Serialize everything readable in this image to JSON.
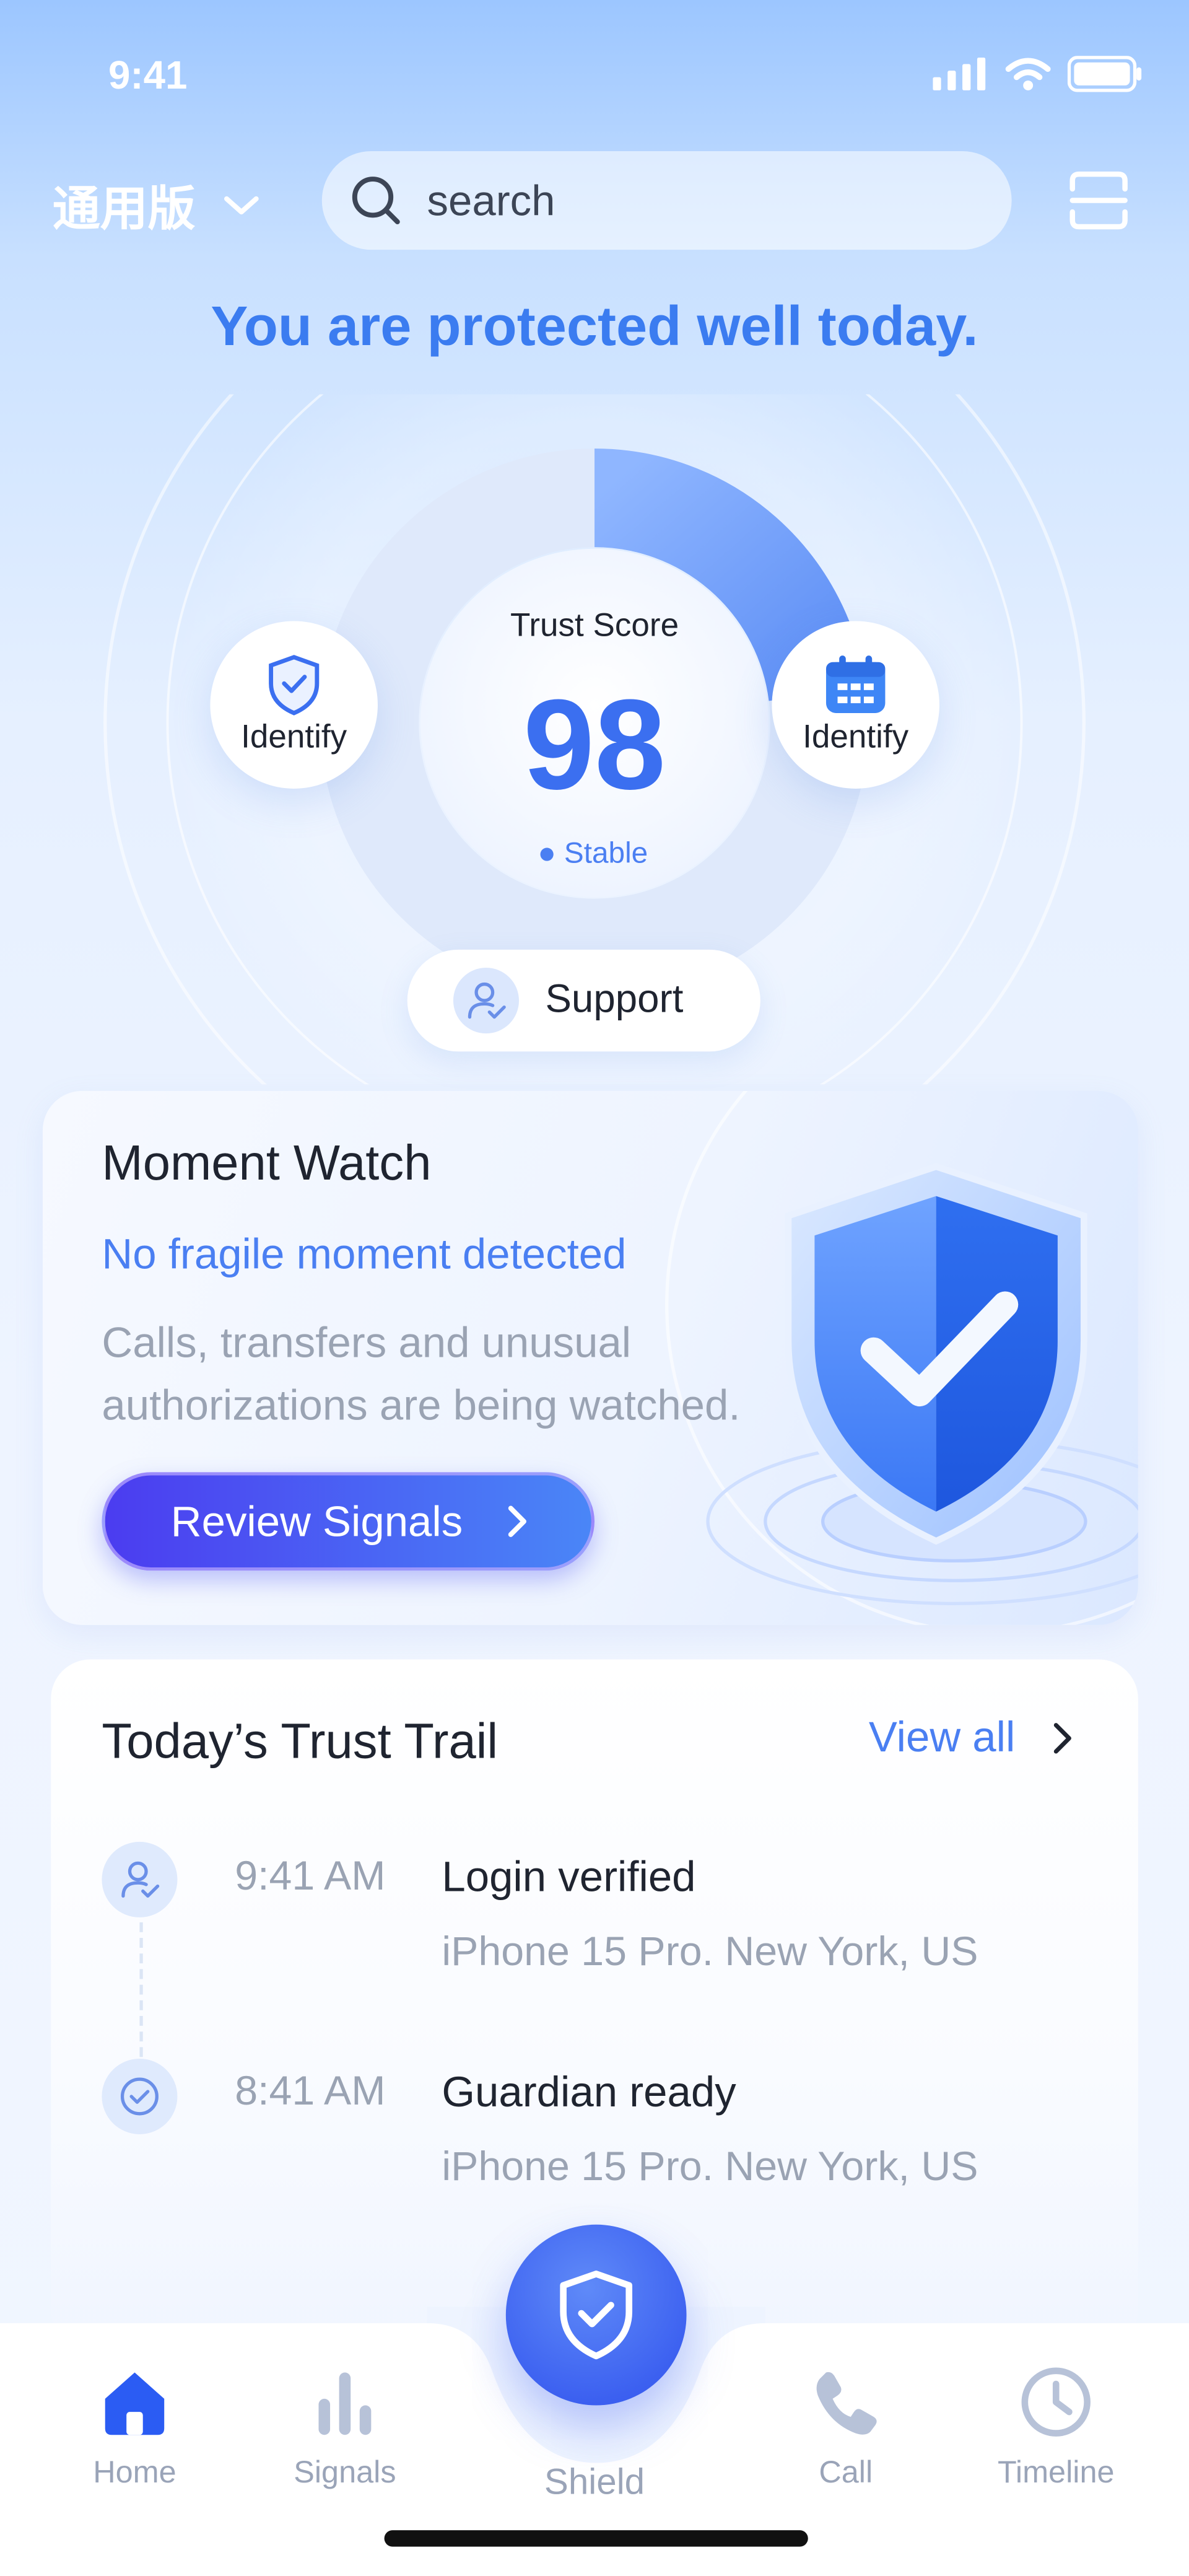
{
  "status_bar": {
    "time": "9:41"
  },
  "header": {
    "edition": "通用版",
    "search_placeholder": "search"
  },
  "headline": "You are protected well today.",
  "trust": {
    "label": "Trust Score",
    "score": "98",
    "state": "Stable",
    "progress": 0.23
  },
  "side_buttons": {
    "left_label": "Identify",
    "right_label": "Identify"
  },
  "support_label": "Support",
  "moment": {
    "title": "Moment Watch",
    "status": "No fragile moment detected",
    "description_line1": "Calls, transfers and unusual",
    "description_line2": "authorizations are being watched.",
    "button_label": "Review Signals"
  },
  "trail": {
    "title": "Today’s Trust Trail",
    "view_all": "View all",
    "items": [
      {
        "time": "9:41 AM",
        "title": "Login verified",
        "subtitle": "iPhone 15 Pro. New York, US"
      },
      {
        "time": "8:41 AM",
        "title": "Guardian ready",
        "subtitle": "iPhone 15 Pro. New York, US"
      }
    ]
  },
  "nav": {
    "items": [
      {
        "label": "Home",
        "icon": "home-icon",
        "active": true
      },
      {
        "label": "Signals",
        "icon": "bar-chart-icon"
      },
      {
        "label": "Shield",
        "icon": "shield-check-icon"
      },
      {
        "label": "Call",
        "icon": "phone-icon"
      },
      {
        "label": "Timeline",
        "icon": "clock-icon"
      }
    ]
  },
  "colors": {
    "accent": "#3b7cf0",
    "primary_dark": "#4b3cf0",
    "nav_active": "#2b5cf3",
    "muted_text": "#9aa4b8"
  }
}
